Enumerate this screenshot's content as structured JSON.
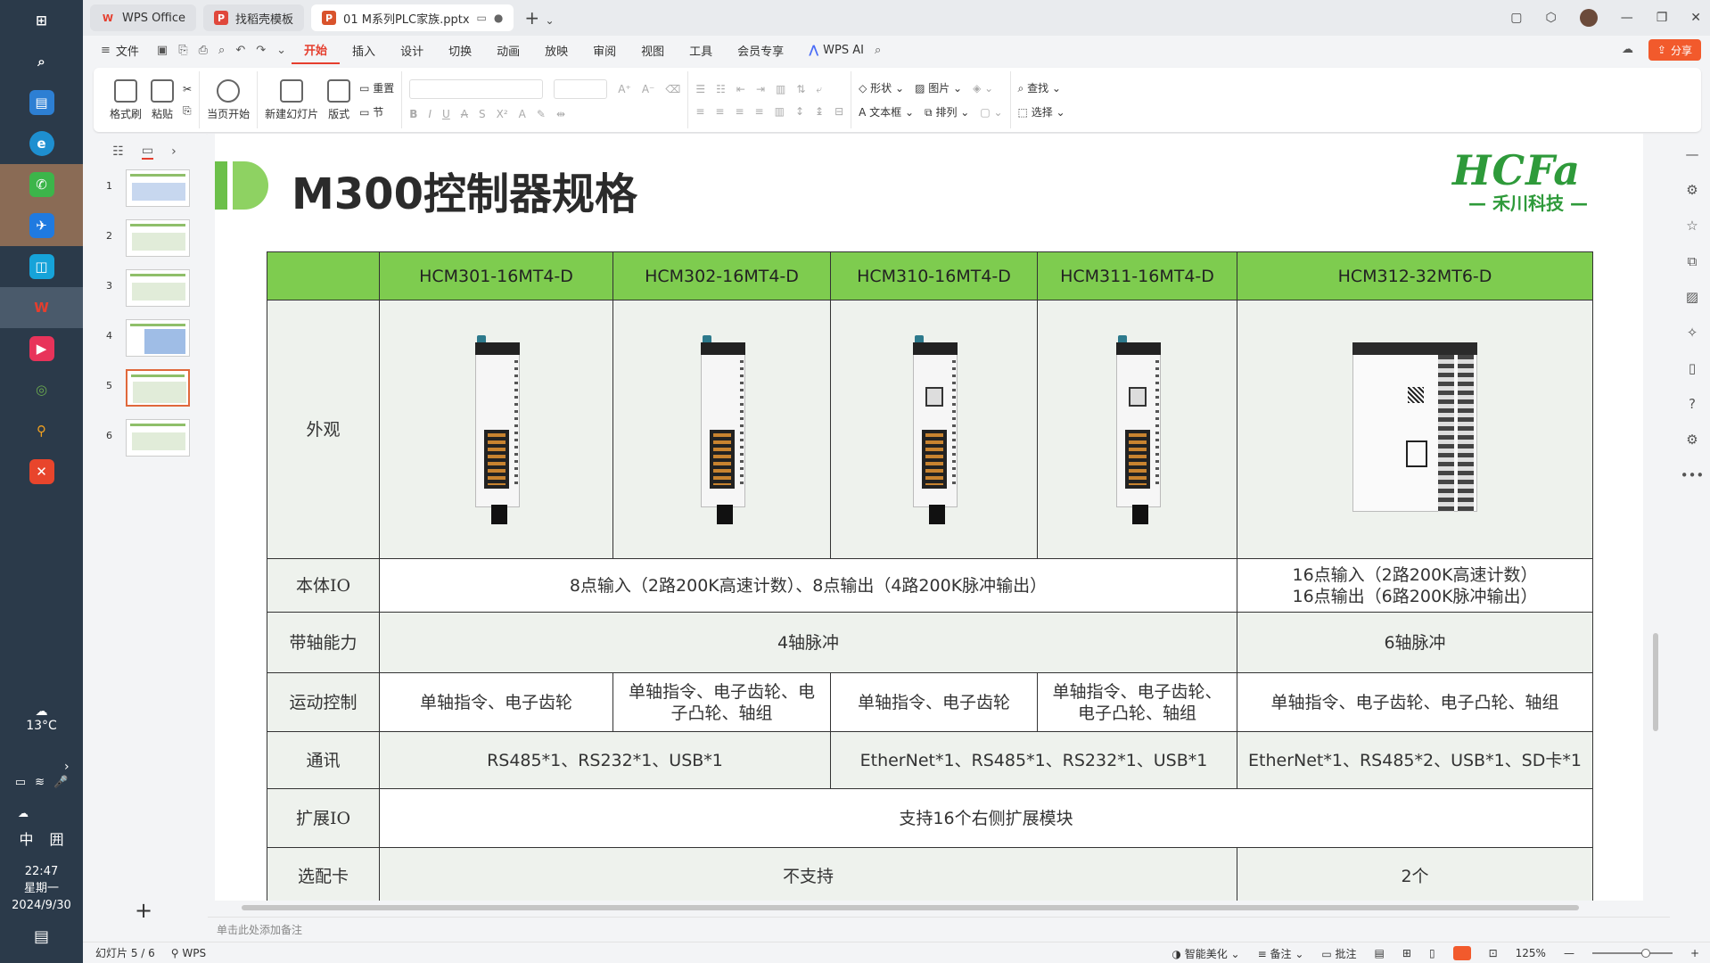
{
  "taskbar": {
    "weather_temp": "13°C",
    "ime_lang": "中",
    "ime_grid": "囲",
    "time": "22:47",
    "weekday": "星期一",
    "date": "2024/9/30"
  },
  "tabs": [
    {
      "label": "WPS Office",
      "logo": "W",
      "color": "#e53e2e"
    },
    {
      "label": "找稻壳模板",
      "logo": "P",
      "color": "#e0483c"
    },
    {
      "label": "01 M系列PLC家族.pptx",
      "logo": "P",
      "color": "#d9532c"
    }
  ],
  "menu": {
    "file": "文件",
    "items": [
      "开始",
      "插入",
      "设计",
      "切换",
      "动画",
      "放映",
      "审阅",
      "视图",
      "工具",
      "会员专享"
    ],
    "wps_ai": "WPS AI",
    "share": "分享"
  },
  "ribbon": {
    "format_brush": "格式刷",
    "paste": "粘贴",
    "from_current": "当页开始",
    "new_slide": "新建幻灯片",
    "layout": "版式",
    "reset": "重置",
    "section": "节",
    "shape": "形状",
    "image": "图片",
    "textbox": "文本框",
    "arrange": "排列",
    "find": "查找",
    "select": "选择"
  },
  "thumbs": [
    "1",
    "2",
    "3",
    "4",
    "5",
    "6"
  ],
  "slide": {
    "title": "M300控制器规格",
    "logo_main": "HCFa",
    "logo_sub": "— 禾川科技 —",
    "table": {
      "models": [
        "HCM301-16MT4-D",
        "HCM302-16MT4-D",
        "HCM310-16MT4-D",
        "HCM311-16MT4-D",
        "HCM312-32MT6-D"
      ],
      "appearance_label": "外观",
      "io_label": "本体IO",
      "io_a": "8点输入（2路200K高速计数）、8点输出（4路200K脉冲输出）",
      "io_b_line1": "16点输入（2路200K高速计数）",
      "io_b_line2": "16点输出（6路200K脉冲输出）",
      "axis_label": "带轴能力",
      "axis_a": "4轴脉冲",
      "axis_b": "6轴脉冲",
      "motion_label": "运动控制",
      "motion": [
        "单轴指令、电子齿轮",
        "单轴指令、电子齿轮、电子凸轮、轴组",
        "单轴指令、电子齿轮",
        "单轴指令、电子齿轮、电子凸轮、轴组",
        "单轴指令、电子齿轮、电子凸轮、轴组"
      ],
      "comm_label": "通讯",
      "comm_a": "RS485*1、RS232*1、USB*1",
      "comm_b": "EtherNet*1、RS485*1、RS232*1、USB*1",
      "comm_c": "EtherNet*1、RS485*2、USB*1、SD卡*1",
      "ext_label": "扩展IO",
      "ext": "支持16个右侧扩展模块",
      "card_label": "选配卡",
      "card_a": "不支持",
      "card_b": "2个"
    }
  },
  "notes_placeholder": "单击此处添加备注",
  "status": {
    "slide_count": "幻灯片 5 / 6",
    "app": "WPS",
    "beautify": "智能美化",
    "notes": "备注",
    "comments": "批注",
    "zoom": "125%"
  }
}
